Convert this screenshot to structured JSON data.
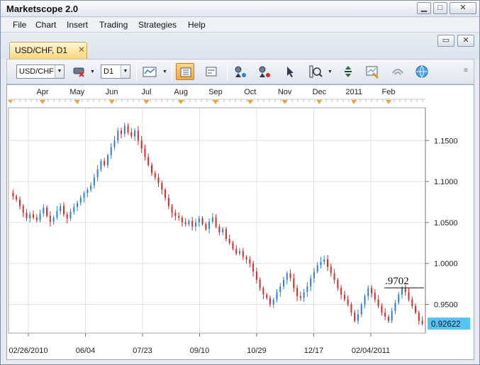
{
  "window": {
    "title": "Marketscope 2.0"
  },
  "menu": [
    "File",
    "Chart",
    "Insert",
    "Trading",
    "Strategies",
    "Help"
  ],
  "tab": {
    "label": "USD/CHF, D1",
    "close": "✕"
  },
  "toolbar": {
    "symbol": "USD/CHF",
    "timeframe": "D1"
  },
  "colors": {
    "up": "#2f7fd3",
    "down": "#d42a2a",
    "price_badge": "#58c3f2"
  },
  "chart_data": {
    "type": "candlestick",
    "instrument": "USD/CHF",
    "timeframe": "D1",
    "top_months": [
      "Apr",
      "May",
      "Jun",
      "Jul",
      "Aug",
      "Sep",
      "Oct",
      "Nov",
      "Dec",
      "2011",
      "Feb"
    ],
    "x_ticks": [
      "02/26/2010",
      "06/04",
      "07/23",
      "09/10",
      "10/29",
      "12/17",
      "02/04/2011"
    ],
    "y_ticks": [
      "1.1500",
      "1.1000",
      "1.0500",
      "1.0000",
      "0.9500"
    ],
    "ylim": [
      0.915,
      1.19
    ],
    "annotation": {
      "text": ".9702",
      "value": 0.9702
    },
    "current_price": "0.92622",
    "closes": [
      1.082,
      1.078,
      1.07,
      1.062,
      1.055,
      1.06,
      1.056,
      1.053,
      1.061,
      1.068,
      1.058,
      1.051,
      1.056,
      1.064,
      1.07,
      1.06,
      1.055,
      1.063,
      1.069,
      1.074,
      1.08,
      1.086,
      1.09,
      1.095,
      1.105,
      1.115,
      1.125,
      1.12,
      1.132,
      1.142,
      1.15,
      1.162,
      1.158,
      1.168,
      1.16,
      1.155,
      1.162,
      1.15,
      1.14,
      1.13,
      1.12,
      1.11,
      1.105,
      1.098,
      1.09,
      1.08,
      1.07,
      1.062,
      1.058,
      1.056,
      1.05,
      1.048,
      1.052,
      1.045,
      1.05,
      1.055,
      1.048,
      1.042,
      1.051,
      1.056,
      1.045,
      1.038,
      1.042,
      1.03,
      1.025,
      1.018,
      1.012,
      1.015,
      1.008,
      1.005,
      1.0,
      0.99,
      0.98,
      0.97,
      0.962,
      0.958,
      0.95,
      0.956,
      0.965,
      0.972,
      0.98,
      0.988,
      0.982,
      0.97,
      0.96,
      0.958,
      0.965,
      0.972,
      0.982,
      0.99,
      0.998,
      1.002,
      1.005,
      0.996,
      0.988,
      0.98,
      0.97,
      0.962,
      0.956,
      0.95,
      0.94,
      0.93,
      0.938,
      0.95,
      0.96,
      0.97,
      0.964,
      0.956,
      0.948,
      0.94,
      0.935,
      0.93,
      0.942,
      0.952,
      0.962,
      0.97,
      0.965,
      0.956,
      0.948,
      0.94,
      0.93,
      0.9262
    ]
  }
}
